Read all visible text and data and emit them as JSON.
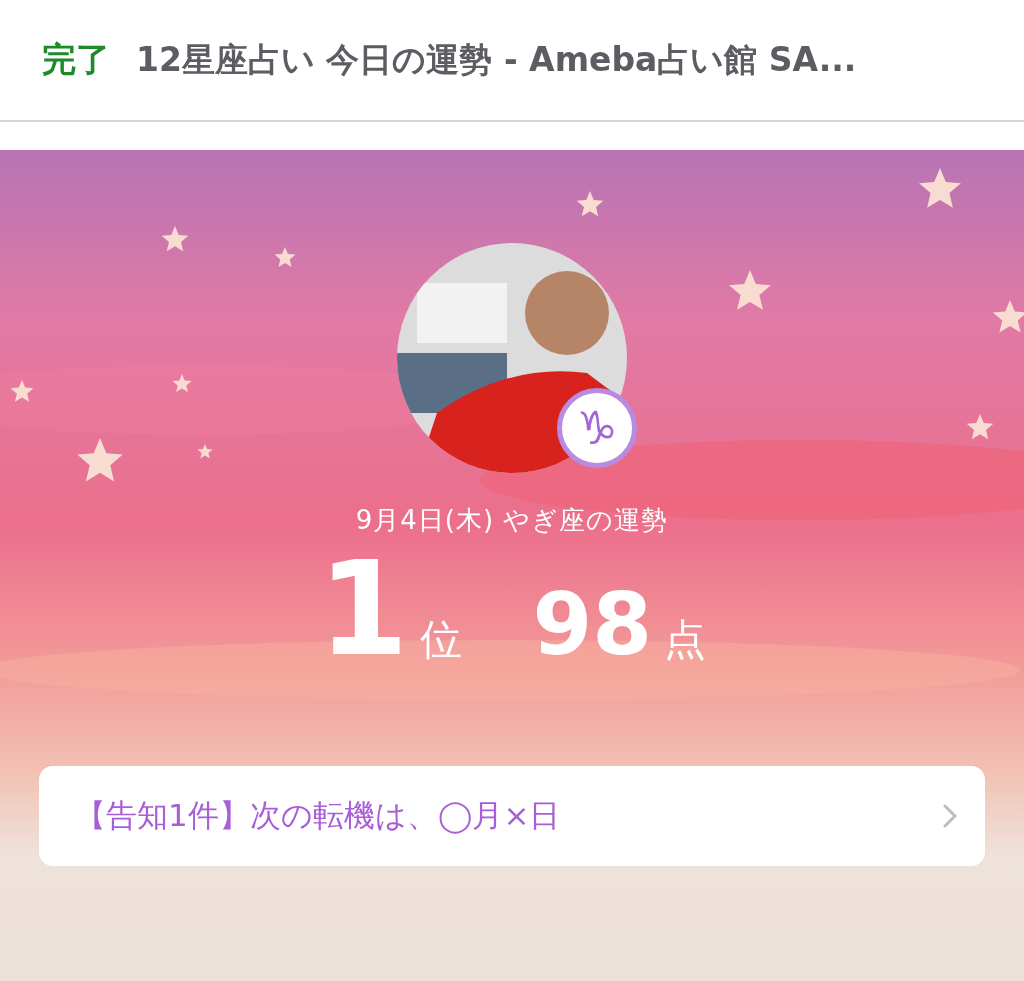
{
  "header": {
    "done": "完了",
    "title": "12星座占い 今日の運勢 - Ameba占い館 SA..."
  },
  "hero": {
    "kind": "picture",
    "sign_glyph": "♑",
    "date_line": "9月4日(木) やぎ座の運勢",
    "rank": {
      "value": "1",
      "unit": "位"
    },
    "score": {
      "value": "98",
      "unit": "点"
    }
  },
  "notice": {
    "text": "【告知1件】次の転機は、◯月×日"
  }
}
